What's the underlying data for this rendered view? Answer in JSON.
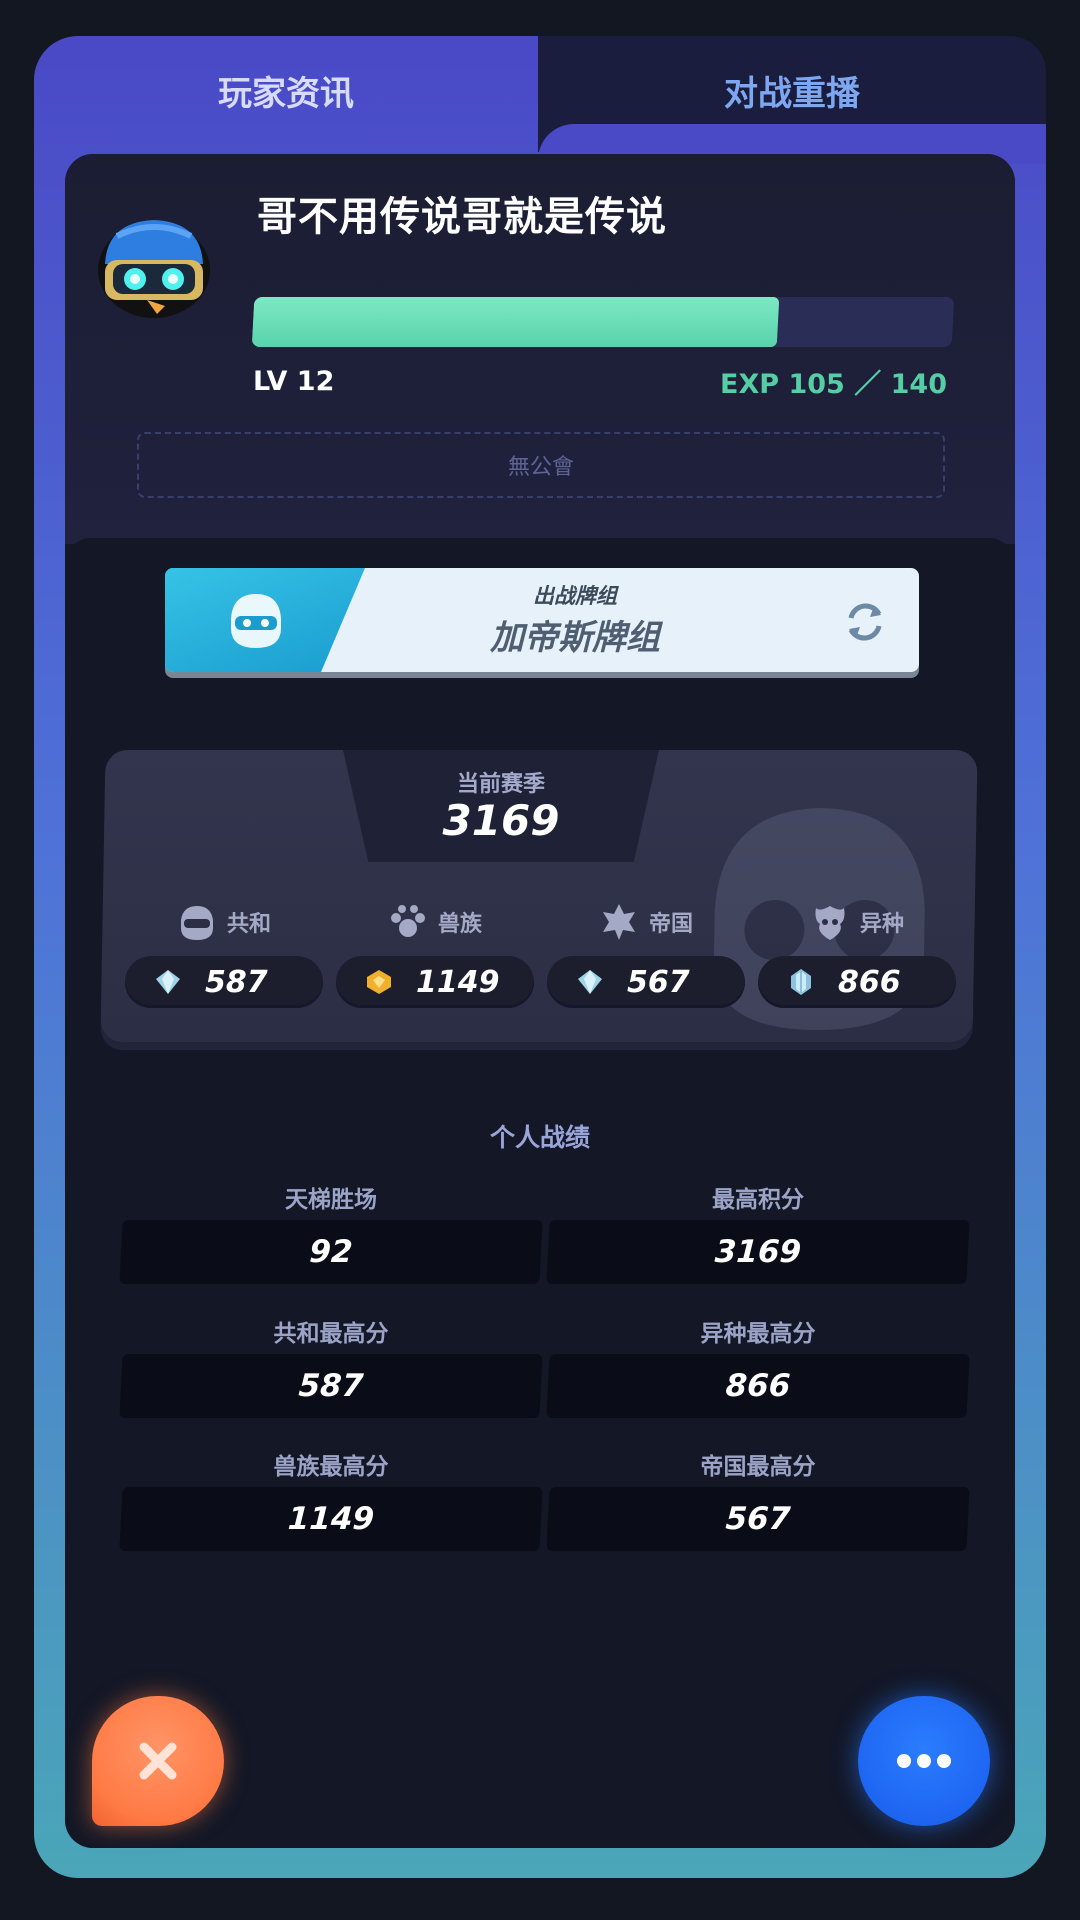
{
  "tabs": {
    "player_info": "玩家资讯",
    "battle_replay": "对战重播"
  },
  "profile": {
    "player_name": "哥不用传说哥就是传说",
    "level_text": "LV 12",
    "exp_text": "EXP 105 ／ 140",
    "exp_current": 105,
    "exp_max": 140,
    "guild_text": "無公會"
  },
  "deck": {
    "label": "出战牌组",
    "name": "加帝斯牌组"
  },
  "season": {
    "label": "当前赛季",
    "score": "3169"
  },
  "factions": [
    {
      "name": "共和",
      "score": "587",
      "icon": "republic-icon",
      "gem": "diamond-gem-icon"
    },
    {
      "name": "兽族",
      "score": "1149",
      "icon": "beast-icon",
      "gem": "gold-gem-icon"
    },
    {
      "name": "帝国",
      "score": "567",
      "icon": "empire-icon",
      "gem": "diamond-gem-icon"
    },
    {
      "name": "异种",
      "score": "866",
      "icon": "mutant-icon",
      "gem": "crystal-gem-icon"
    }
  ],
  "stats": {
    "title": "个人战绩",
    "items": [
      {
        "label": "天梯胜场",
        "value": "92"
      },
      {
        "label": "最高积分",
        "value": "3169"
      },
      {
        "label": "共和最高分",
        "value": "587"
      },
      {
        "label": "异种最高分",
        "value": "866"
      },
      {
        "label": "兽族最高分",
        "value": "1149"
      },
      {
        "label": "帝国最高分",
        "value": "567"
      }
    ]
  },
  "colors": {
    "accent_exp": "#58d3ab",
    "close_button": "#ff7a45",
    "more_button": "#1e66f2"
  }
}
